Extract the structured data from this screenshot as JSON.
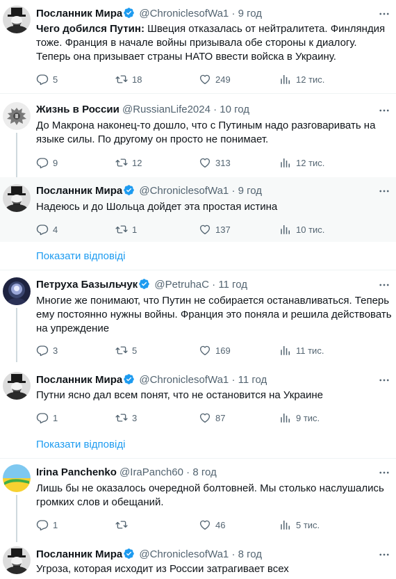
{
  "show_replies_label": "Показати відповіді",
  "tweets": [
    {
      "name": "Посланник Мира",
      "handle": "@ChroniclesofWa1",
      "sep": "·",
      "time": "9 год",
      "bold_prefix": "Чего добился Путин:",
      "text": " Швеция отказалась от нейтралитета. Финляндия тоже. Франция в начале войны призывала обе стороны к диалогу. Теперь она призывает страны НАТО ввести войска в Украину.",
      "replies": "5",
      "retweets": "18",
      "likes": "249",
      "views": "12 тис."
    },
    {
      "name": "Жизнь в России",
      "handle": "@RussianLife2024",
      "sep": "·",
      "time": "10 год",
      "text": "До Макрона наконец-то дошло, что с Путиным надо разговаривать на языке силы. По другому он просто не понимает.",
      "replies": "9",
      "retweets": "12",
      "likes": "313",
      "views": "12 тис."
    },
    {
      "name": "Посланник Мира",
      "handle": "@ChroniclesofWa1",
      "sep": "·",
      "time": "9 год",
      "text": "Надеюсь и до Шольца дойдет эта простая истина",
      "replies": "4",
      "retweets": "1",
      "likes": "137",
      "views": "10 тис."
    },
    {
      "name": "Петруха Базыльчук",
      "handle": "@PetruhaC",
      "sep": "·",
      "time": "11 год",
      "text": "Многие же понимают, что Путин не собирается останавливаться. Теперь ему постоянно нужны войны. Франция это поняла и решила действовать на упреждение",
      "replies": "3",
      "retweets": "5",
      "likes": "169",
      "views": "11 тис."
    },
    {
      "name": "Посланник Мира",
      "handle": "@ChroniclesofWa1",
      "sep": "·",
      "time": "11 год",
      "text": "Путни ясно дал всем понят, что не остановится на Украине",
      "replies": "1",
      "retweets": "3",
      "likes": "87",
      "views": "9 тис."
    },
    {
      "name": "Irina Panchenko",
      "handle": "@IraPanch60",
      "sep": "·",
      "time": "8 год",
      "text": "Лишь бы не оказалось очередной болтовней. Мы столько наслушались громких слов и обещаний.",
      "replies": "1",
      "retweets": "",
      "likes": "46",
      "views": "5 тис."
    },
    {
      "name": "Посланник Мира",
      "handle": "@ChroniclesofWa1",
      "sep": "·",
      "time": "8 год",
      "text": "Угроза, которая исходит из России затрагивает всех"
    }
  ]
}
